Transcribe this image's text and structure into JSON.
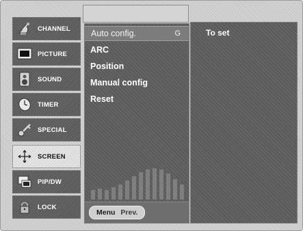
{
  "sidebar": {
    "items": [
      {
        "label": "CHANNEL",
        "icon": "satellite-dish-icon",
        "active": false
      },
      {
        "label": "PICTURE",
        "icon": "monitor-icon",
        "active": false
      },
      {
        "label": "SOUND",
        "icon": "speaker-icon",
        "active": false
      },
      {
        "label": "TIMER",
        "icon": "clock-icon",
        "active": false
      },
      {
        "label": "SPECIAL",
        "icon": "key-icon",
        "active": false
      },
      {
        "label": "SCREEN",
        "icon": "move-arrows-icon",
        "active": true
      },
      {
        "label": "PIP/DW",
        "icon": "pip-windows-icon",
        "active": false
      },
      {
        "label": "LOCK",
        "icon": "lock-icon",
        "active": false
      }
    ]
  },
  "submenu": {
    "items": [
      {
        "label": "Auto config.",
        "key": "G",
        "selected": true
      },
      {
        "label": "ARC",
        "key": "",
        "selected": false
      },
      {
        "label": "Position",
        "key": "",
        "selected": false
      },
      {
        "label": "Manual config",
        "key": "",
        "selected": false
      },
      {
        "label": "Reset",
        "key": "",
        "selected": false
      }
    ],
    "footer": {
      "menu_label": "Menu",
      "action_label": "Prev."
    }
  },
  "right_panel": {
    "text": "To set"
  },
  "colors": {
    "frame": "#c9c9c9",
    "panel": "#5b5b5b",
    "selected_row": "#7c7c7c",
    "active_tab": "#d9d9d9",
    "text": "#ffffff"
  }
}
